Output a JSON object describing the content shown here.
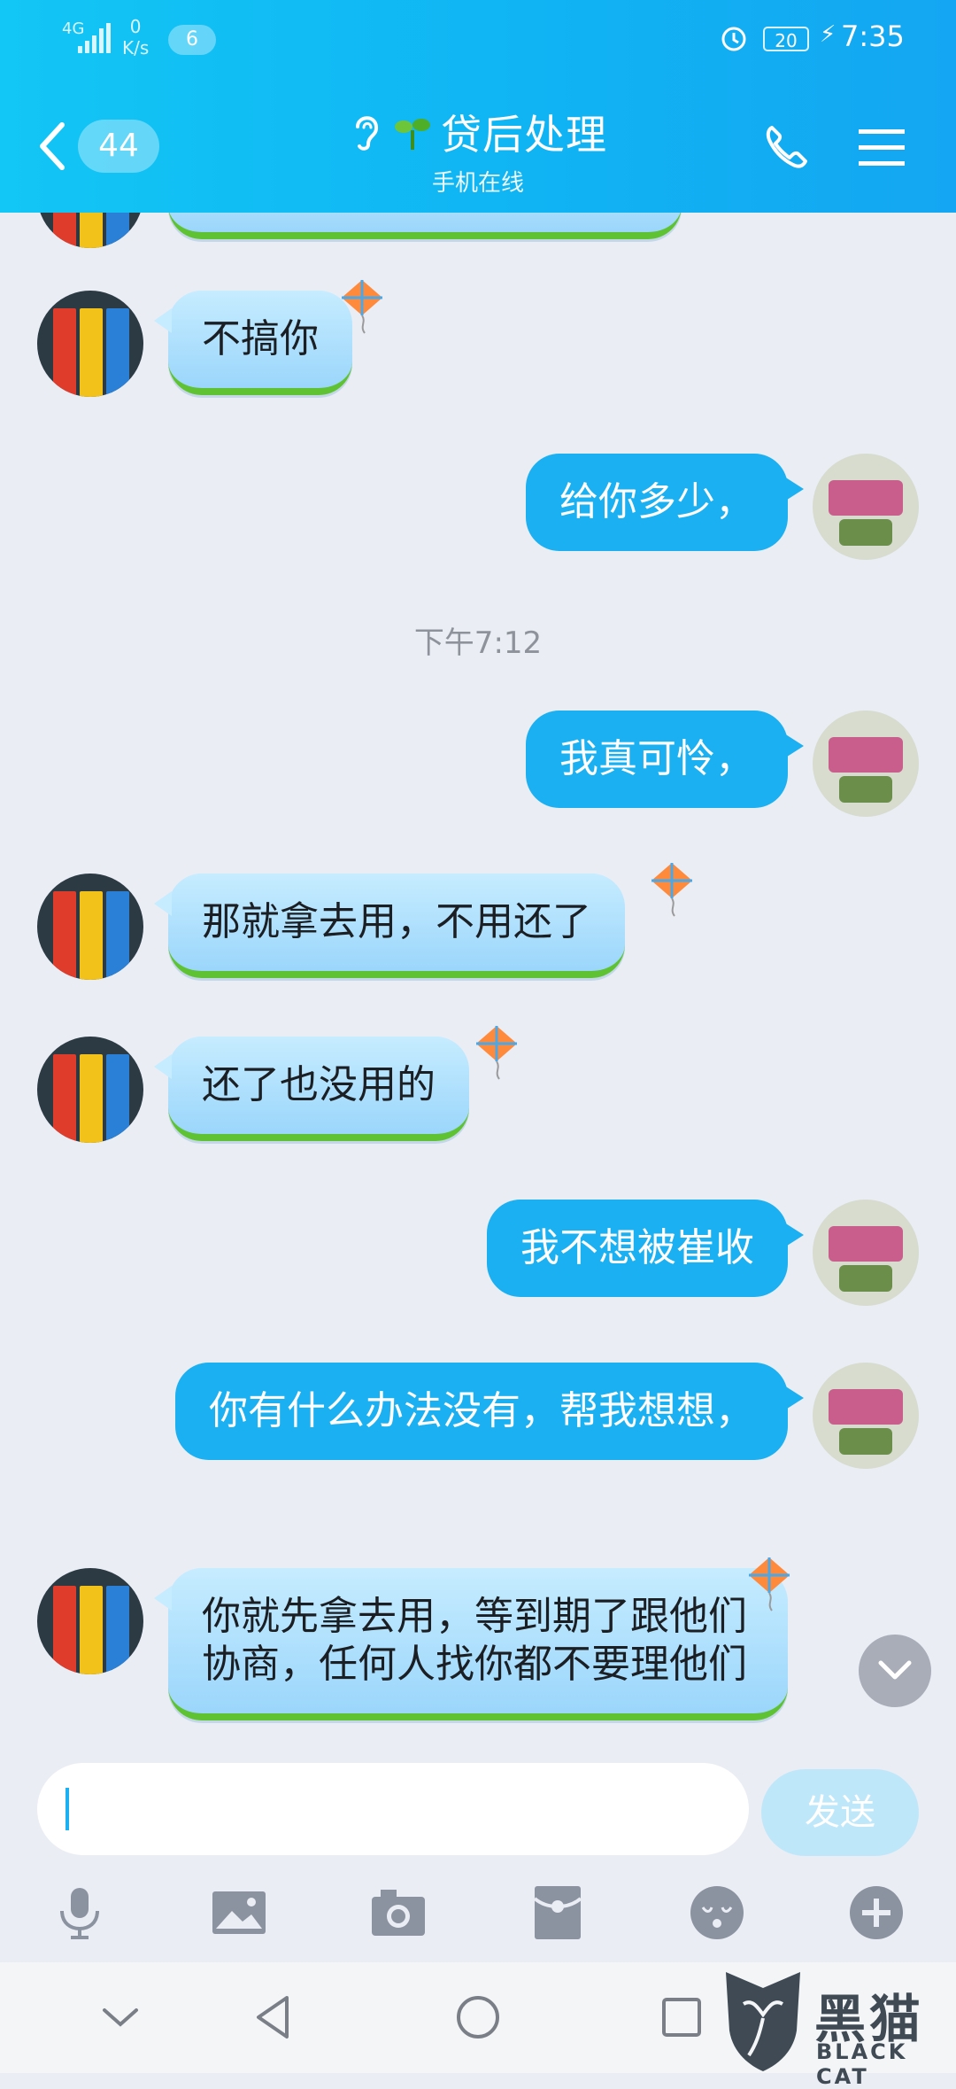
{
  "status_bar": {
    "network": "4G",
    "speed_value": "0",
    "speed_unit": "K/s",
    "notification_count": "6",
    "battery": "20",
    "time": "7:35"
  },
  "header": {
    "unread_count": "44",
    "title": "贷后处理",
    "subtitle": "手机在线"
  },
  "messages": [
    {
      "side": "in",
      "text": "不搞你"
    },
    {
      "side": "out",
      "text": "给你多少，"
    },
    {
      "side": "time",
      "text": "下午7:12"
    },
    {
      "side": "out",
      "text": "我真可怜，"
    },
    {
      "side": "in",
      "text": "那就拿去用，不用还了"
    },
    {
      "side": "in",
      "text": "还了也没用的"
    },
    {
      "side": "out",
      "text": "我不想被崔收"
    },
    {
      "side": "out",
      "text": "你有什么办法没有，帮我想想，"
    },
    {
      "side": "in",
      "text": "你就先拿去用，等到期了跟他们协商，任何人找你都不要理他们"
    }
  ],
  "input": {
    "value": "",
    "send_label": "发送"
  },
  "toolbar_icons": [
    "microphone-icon",
    "image-icon",
    "camera-icon",
    "red-envelope-icon",
    "emoji-icon",
    "plus-icon"
  ],
  "watermark": {
    "text": "黑猫",
    "sub": "BLACK CAT"
  },
  "colors": {
    "header": "#12b8f4",
    "out_bubble": "#1ab0f2",
    "in_bubble": "#b9e4fd",
    "in_bubble_border": "#5fc233",
    "background": "#eaedf4"
  }
}
